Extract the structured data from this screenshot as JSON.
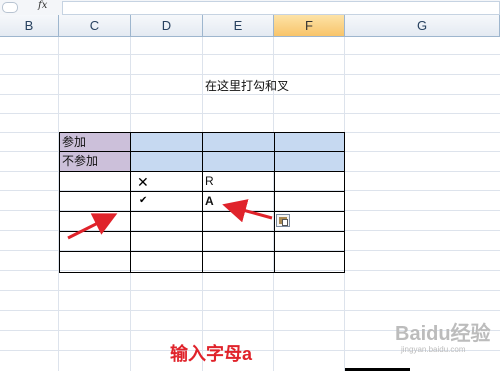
{
  "formula_bar": {
    "fx_label": "fx"
  },
  "columns": [
    "B",
    "C",
    "D",
    "E",
    "F",
    "G"
  ],
  "selected_column": "F",
  "sheet": {
    "note": "在这里打勾和叉",
    "rows": [
      {
        "label": "参加"
      },
      {
        "label": "不参加"
      }
    ],
    "marks": {
      "cross": "✕",
      "check": "✔"
    },
    "values": {
      "E3": "R",
      "E4": "A"
    }
  },
  "annotation": {
    "caption": "输入字母a"
  },
  "watermark": {
    "logo": "Baidu经验",
    "url": "jingyan.baidu.com"
  },
  "colors": {
    "purple_fill": "#ccc0da",
    "blue_fill": "#c6d9f1",
    "arrow_red": "#e0232b",
    "selected_header": "#f8c46a"
  }
}
